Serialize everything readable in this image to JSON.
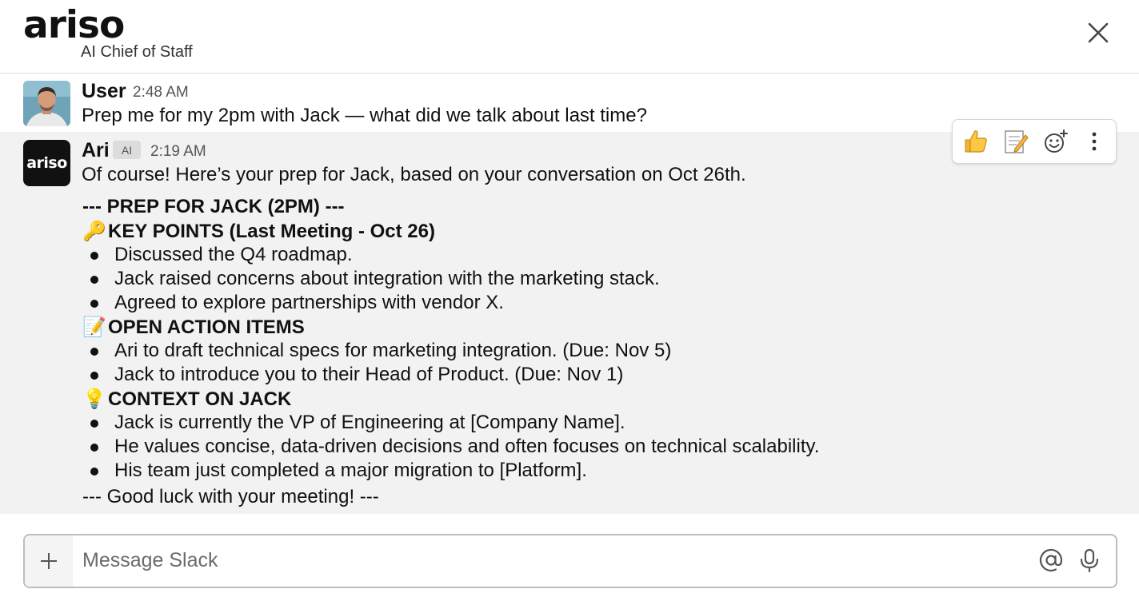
{
  "header": {
    "logo": "ariso",
    "subtitle": "AI Chief of Staff"
  },
  "messages": {
    "user": {
      "name": "User",
      "time": "2:48 AM",
      "text": "Prep me for my 2pm with Jack — what did we talk about last time?"
    },
    "ari": {
      "name": "Ari",
      "badge": "AI",
      "time": "2:19 AM",
      "avatar_text": "ariso",
      "intro": "Of course! Here’s your prep for Jack, based on your conversation on Oct 26th.",
      "header_line": "--- PREP FOR JACK (2PM) ---",
      "sections": [
        {
          "icon": "key",
          "emoji": "🔑",
          "title": "KEY POINTS (Last Meeting - Oct 26)",
          "items": [
            "Discussed the Q4 roadmap.",
            "Jack raised concerns about integration with the marketing stack.",
            "Agreed to explore partnerships with vendor X."
          ]
        },
        {
          "icon": "memo",
          "emoji": "📝",
          "title": "OPEN ACTION ITEMS",
          "items": [
            "Ari to draft technical specs for marketing integration. (Due: Nov 5)",
            "Jack to introduce you to their Head of Product. (Due: Nov 1)"
          ]
        },
        {
          "icon": "lightbulb",
          "emoji": "💡",
          "title": "CONTEXT ON JACK",
          "items": [
            "Jack is currently the VP of Engineering at [Company Name].",
            "He values concise, data-driven decisions and often focuses on technical scalability.",
            "His team just completed a major migration to [Platform]."
          ]
        }
      ],
      "footer_line": "--- Good luck with your meeting! ---"
    }
  },
  "actions": [
    "thumbs-up-icon",
    "memo-icon",
    "add-reaction-icon",
    "more-options-icon"
  ],
  "composer": {
    "placeholder": "Message Slack"
  }
}
